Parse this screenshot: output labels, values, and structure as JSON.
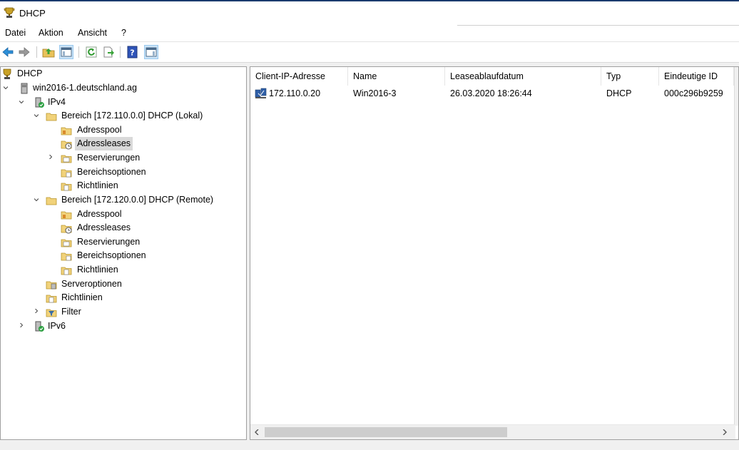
{
  "window": {
    "title": "DHCP",
    "app_icon": "trophy-icon"
  },
  "menu": {
    "items": [
      "Datei",
      "Aktion",
      "Ansicht",
      "?"
    ]
  },
  "toolbar": {
    "buttons": [
      "back-icon",
      "forward-icon",
      "up-folder-icon",
      "show-hide-console-tree-icon",
      "refresh-icon",
      "export-list-icon",
      "help-icon",
      "show-hide-action-pane-icon"
    ]
  },
  "tree": {
    "root": "DHCP",
    "server": "win2016-1.deutschland.ag",
    "ipv4": "IPv4",
    "scope1": {
      "label": "Bereich [172.110.0.0] DHCP (Lokal)",
      "children": [
        "Adresspool",
        "Adressleases",
        "Reservierungen",
        "Bereichsoptionen",
        "Richtlinien"
      ]
    },
    "scope2": {
      "label": "Bereich [172.120.0.0] DHCP (Remote)",
      "children": [
        "Adresspool",
        "Adressleases",
        "Reservierungen",
        "Bereichsoptionen",
        "Richtlinien"
      ]
    },
    "serveroptions": "Serveroptionen",
    "policies": "Richtlinien",
    "filter": "Filter",
    "ipv6": "IPv6"
  },
  "table": {
    "columns": [
      "Client-IP-Adresse",
      "Name",
      "Leaseablaufdatum",
      "Typ",
      "Eindeutige ID"
    ],
    "rows": [
      {
        "ip": "172.110.0.20",
        "name": "Win2016-3",
        "expiry": "26.03.2020 18:26:44",
        "type": "DHCP",
        "uid": "000c296b9259"
      }
    ]
  },
  "colors": {
    "accent": "#1a3a6e",
    "selection": "#d9d9d9",
    "toolbar_selected": "#cce4f7"
  }
}
